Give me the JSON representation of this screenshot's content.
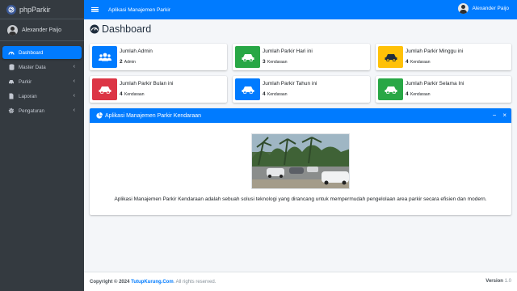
{
  "brand": {
    "name": "phpParkir"
  },
  "sidebar": {
    "user": "Alexander Paijo",
    "items": [
      {
        "label": "Dashboard",
        "icon": "dashboard-icon"
      },
      {
        "label": "Master Data",
        "icon": "database-icon"
      },
      {
        "label": "Parkir",
        "icon": "car-icon"
      },
      {
        "label": "Laporan",
        "icon": "file-icon"
      },
      {
        "label": "Pengaturan",
        "icon": "gear-icon"
      }
    ]
  },
  "topbar": {
    "title": "Aplikasi Manajemen Parkir",
    "user": "Alexander Paijo"
  },
  "page": {
    "title": "Dashboard"
  },
  "stats": [
    {
      "label": "Jumlah Admin",
      "value": "2",
      "unit": "Admin",
      "color": "#007bff",
      "icon": "users-icon"
    },
    {
      "label": "Jumlah Parkir Hari ini",
      "value": "3",
      "unit": "Kendaraan",
      "color": "#28a745",
      "icon": "car-icon"
    },
    {
      "label": "Jumlah Parkir Minggu ini",
      "value": "4",
      "unit": "Kendaraan",
      "color": "#ffc107",
      "icon": "car-icon"
    },
    {
      "label": "Jumlah Parkir Bulan ini",
      "value": "4",
      "unit": "Kendaraan",
      "color": "#dc3545",
      "icon": "car-icon"
    },
    {
      "label": "Jumlah Parkir Tahun ini",
      "value": "4",
      "unit": "Kendaraan",
      "color": "#007bff",
      "icon": "car-icon"
    },
    {
      "label": "Jumlah Parkir Selama Ini",
      "value": "4",
      "unit": "Kendaraan",
      "color": "#28a745",
      "icon": "car-icon"
    }
  ],
  "card": {
    "title": "Aplikasi Manajemen Parkir Kendaraan",
    "description": "Aplikasi Manajemen Parkir Kendaraan adalah sebuah solusi teknologi yang dirancang untuk mempermudah pengelolaan area parkir secara efisien dan modern."
  },
  "footer": {
    "copyright": "Copyright © 2024",
    "link": "TutupKurung.Com",
    "rights": ". All rights reserved.",
    "version_label": "Version",
    "version": "1.0"
  },
  "colors": {
    "primary": "#007bff",
    "sidebar": "#343a40",
    "success": "#28a745",
    "warning": "#ffc107",
    "danger": "#dc3545"
  }
}
